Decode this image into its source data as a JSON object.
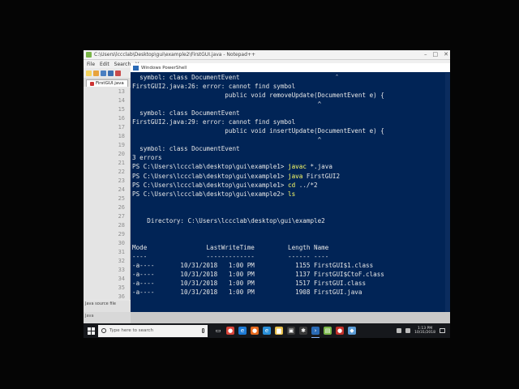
{
  "notepad": {
    "title": "C:\\Users\\lccclab\\Desktop\\gui\\example2\\FirstGUI.java - Notepad++",
    "menu": [
      "File",
      "Edit",
      "Search",
      "V"
    ],
    "tab_label": "FirstGUI.java",
    "line_numbers": [
      "13",
      "14",
      "15",
      "16",
      "17",
      "18",
      "19",
      "20",
      "21",
      "22",
      "23",
      "24",
      "25",
      "26",
      "27",
      "28",
      "29",
      "30",
      "31",
      "32",
      "33",
      "34",
      "35",
      "36"
    ],
    "status_text": "Java source file",
    "hint_text": "Java"
  },
  "powershell": {
    "title": "Windows PowerShell",
    "lines": [
      {
        "type": "text",
        "text": "  symbol: class DocumentEvent"
      },
      {
        "type": "text",
        "text": "FirstGUI2.java:26: error: cannot find symbol"
      },
      {
        "type": "text",
        "text": "                         public void removeUpdate(DocumentEvent e) {"
      },
      {
        "type": "text",
        "text": "                                                  ^"
      },
      {
        "type": "text",
        "text": "  symbol: class DocumentEvent"
      },
      {
        "type": "text",
        "text": "FirstGUI2.java:29: error: cannot find symbol"
      },
      {
        "type": "text",
        "text": "                         public void insertUpdate(DocumentEvent e) {"
      },
      {
        "type": "text",
        "text": "                                                  ^"
      },
      {
        "type": "text",
        "text": "  symbol: class DocumentEvent"
      },
      {
        "type": "text",
        "text": "3 errors"
      },
      {
        "type": "cmd",
        "prompt": "PS C:\\Users\\lccclab\\desktop\\gui\\example1> ",
        "cmd": "javac",
        "args": " *.java"
      },
      {
        "type": "cmd",
        "prompt": "PS C:\\Users\\lccclab\\desktop\\gui\\example1> ",
        "cmd": "java",
        "args": " FirstGUI2"
      },
      {
        "type": "cmd",
        "prompt": "PS C:\\Users\\lccclab\\desktop\\gui\\example1> ",
        "cmd": "cd",
        "args": " ../*2"
      },
      {
        "type": "cmd",
        "prompt": "PS C:\\Users\\lccclab\\desktop\\gui\\example2> ",
        "cmd": "ls",
        "args": ""
      },
      {
        "type": "text",
        "text": ""
      },
      {
        "type": "text",
        "text": ""
      },
      {
        "type": "text",
        "text": "    Directory: C:\\Users\\lccclab\\desktop\\gui\\example2"
      },
      {
        "type": "text",
        "text": ""
      },
      {
        "type": "text",
        "text": ""
      },
      {
        "type": "text",
        "text": "Mode                LastWriteTime         Length Name"
      },
      {
        "type": "text",
        "text": "----                -------------         ------ ----"
      },
      {
        "type": "text",
        "text": "-a----       10/31/2018   1:00 PM           1155 FirstGUI$1.class"
      },
      {
        "type": "text",
        "text": "-a----       10/31/2018   1:00 PM           1137 FirstGUI$CtoF.class"
      },
      {
        "type": "text",
        "text": "-a----       10/31/2018   1:00 PM           1517 FirstGUI.class"
      },
      {
        "type": "text",
        "text": "-a----       10/31/2018   1:00 PM           1908 FirstGUI.java"
      }
    ],
    "caret_top": "^"
  },
  "taskbar": {
    "search_placeholder": "Type here to search",
    "clock_time": "1:13 PM",
    "clock_date": "10/31/2018",
    "apps": [
      {
        "name": "task-view-icon",
        "glyph": "▭",
        "color": "#16181c"
      },
      {
        "name": "chrome-icon",
        "glyph": "●",
        "color": "#d9453a"
      },
      {
        "name": "edge-icon",
        "glyph": "e",
        "color": "#1e7bd6"
      },
      {
        "name": "firefox-icon",
        "glyph": "●",
        "color": "#e66a1f"
      },
      {
        "name": "ie-icon",
        "glyph": "e",
        "color": "#2a8fd8"
      },
      {
        "name": "file-explorer-icon",
        "glyph": "▆",
        "color": "#e8c04a"
      },
      {
        "name": "store-icon",
        "glyph": "▣",
        "color": "#3a3a3a"
      },
      {
        "name": "settings-icon",
        "glyph": "✱",
        "color": "#3a3a3a"
      },
      {
        "name": "powershell-icon",
        "glyph": "›",
        "color": "#2a6ab5"
      },
      {
        "name": "notepadpp-icon",
        "glyph": "▤",
        "color": "#7ab648"
      },
      {
        "name": "media-icon",
        "glyph": "●",
        "color": "#c2312a"
      },
      {
        "name": "app-icon",
        "glyph": "◆",
        "color": "#5a9bd5"
      }
    ]
  },
  "colors": {
    "powershell_bg": "#012456",
    "command_highlight": "#ffff66",
    "taskbar_bg": "#16181c"
  }
}
